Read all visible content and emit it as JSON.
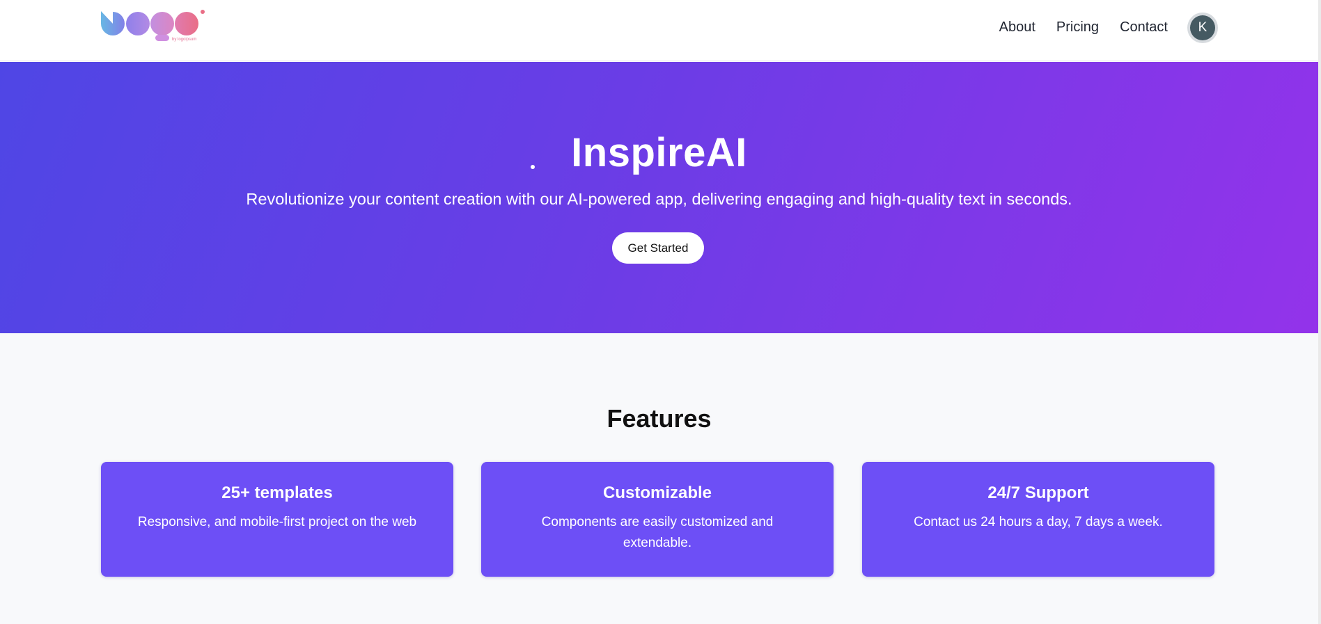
{
  "header": {
    "logo": {
      "icon": "logo-icon",
      "colors": [
        "#5fb3e2",
        "#7c7ae6",
        "#c38fe0",
        "#e7708f"
      ],
      "subtext": "by logoipsum"
    },
    "nav": [
      {
        "label": "About"
      },
      {
        "label": "Pricing"
      },
      {
        "label": "Contact"
      }
    ],
    "avatar": {
      "initial": "K",
      "color": "#455a62"
    }
  },
  "hero": {
    "title": "InspireAI",
    "subtitle": "Revolutionize your content creation with our AI-powered app, delivering engaging and high-quality text in seconds.",
    "cta_label": "Get Started",
    "gradient": [
      "#4f46e5",
      "#9333ea"
    ]
  },
  "features": {
    "title": "Features",
    "card_color": "#6d4ff6",
    "items": [
      {
        "title": "25+ templates",
        "text": "Responsive, and mobile-first project on the web"
      },
      {
        "title": "Customizable",
        "text": "Components are easily customized and extendable."
      },
      {
        "title": "24/7 Support",
        "text": "Contact us 24 hours a day, 7 days a week."
      }
    ]
  }
}
